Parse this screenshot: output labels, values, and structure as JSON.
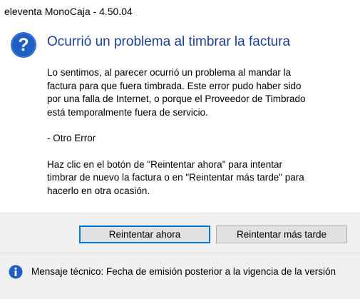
{
  "window": {
    "title": "eleventa MonoCaja - 4.50.04"
  },
  "dialog": {
    "icon": "question-icon",
    "heading": "Ocurrió un problema al timbrar la factura",
    "paragraphs": [
      "Lo sentimos, al parecer ocurrió un problema al mandar la\nfactura para que fuera timbrada. Este error pudo haber sido\npor una falla de Internet, o porque el Proveedor de Timbrado\nestá temporalmente fuera de servicio.",
      "- Otro Error",
      "Haz clic en el botón de \"Reintentar ahora\" para intentar\ntimbrar de nuevo la factura o en \"Reintentar más tarde\" para\nhacerlo en otra ocasión."
    ]
  },
  "buttons": {
    "retry_now": "Reintentar ahora",
    "retry_later": "Reintentar más tarde"
  },
  "footer": {
    "icon": "info-icon",
    "text": "Mensaje técnico: Fecha de emisión posterior a la vigencia de la versión"
  },
  "colors": {
    "accent": "#1f5fc4",
    "heading": "#1c3f95",
    "focus_border": "#0078d7",
    "panel_bg": "#f0f0f0"
  }
}
